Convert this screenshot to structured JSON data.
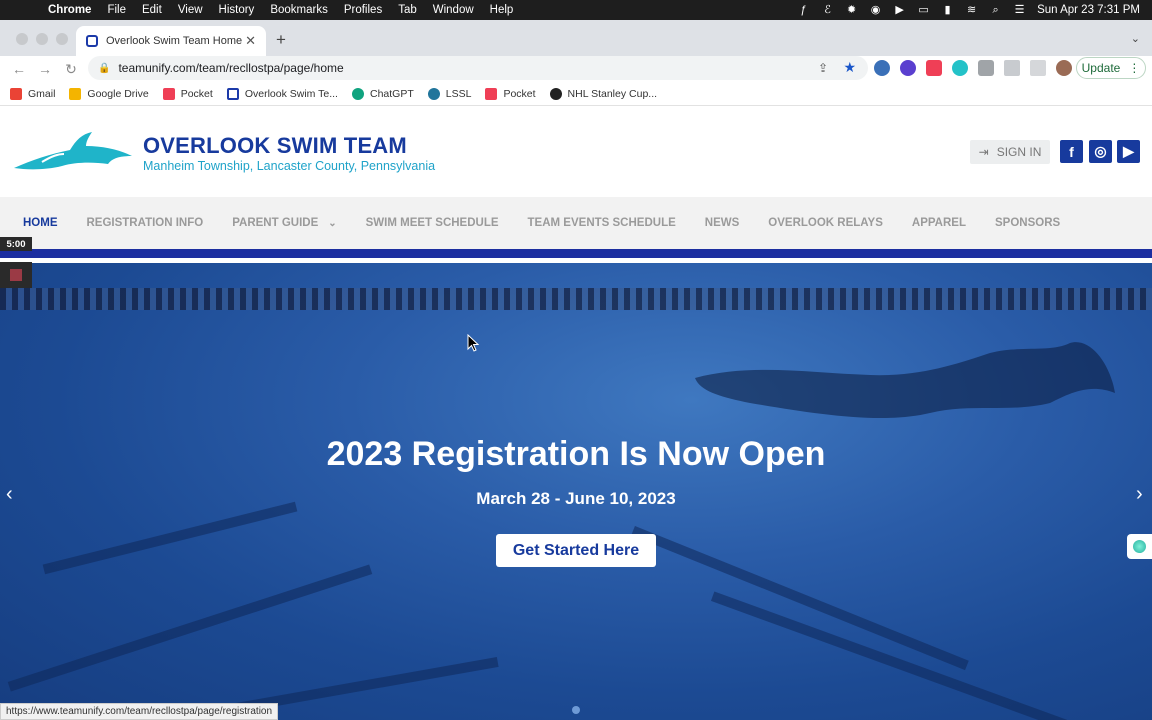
{
  "menubar": {
    "app": "Chrome",
    "items": [
      "File",
      "Edit",
      "View",
      "History",
      "Bookmarks",
      "Profiles",
      "Tab",
      "Window",
      "Help"
    ],
    "datetime": "Sun Apr 23  7:31 PM"
  },
  "browser": {
    "tab_title": "Overlook Swim Team Home",
    "url": "teamunify.com/team/recllostpa/page/home",
    "update_label": "Update",
    "status_url": "https://www.teamunify.com/team/recllostpa/page/registration"
  },
  "bookmarks": [
    {
      "label": "Gmail",
      "color": "#ea4335"
    },
    {
      "label": "Google Drive",
      "color": "#f4b400"
    },
    {
      "label": "Pocket",
      "color": "#ef3f56"
    },
    {
      "label": "Overlook Swim Te...",
      "color": "#1c3aa9"
    },
    {
      "label": "ChatGPT",
      "color": "#10a37f"
    },
    {
      "label": "LSSL",
      "color": "#21759b"
    },
    {
      "label": "Pocket",
      "color": "#ef3f56"
    },
    {
      "label": "NHL Stanley Cup...",
      "color": "#222222"
    }
  ],
  "site": {
    "title": "OVERLOOK SWIM TEAM",
    "subtitle": "Manheim Township, Lancaster County, Pennsylvania",
    "signin_label": "SIGN IN",
    "nav": [
      {
        "label": "HOME",
        "active": true
      },
      {
        "label": "REGISTRATION INFO"
      },
      {
        "label": "PARENT GUIDE",
        "dropdown": true
      },
      {
        "label": "SWIM MEET SCHEDULE"
      },
      {
        "label": "TEAM EVENTS SCHEDULE"
      },
      {
        "label": "NEWS"
      },
      {
        "label": "OVERLOOK RELAYS"
      },
      {
        "label": "APPAREL"
      },
      {
        "label": "SPONSORS"
      }
    ]
  },
  "hero": {
    "title": "2023 Registration Is Now Open",
    "dates": "March 28 - June 10, 2023",
    "cta_label": "Get Started Here"
  },
  "recorder": {
    "timer": "5:00"
  },
  "colors": {
    "brand": "#173a9d",
    "accent": "#1fa3c9",
    "stripe": "#1c2ea0"
  }
}
